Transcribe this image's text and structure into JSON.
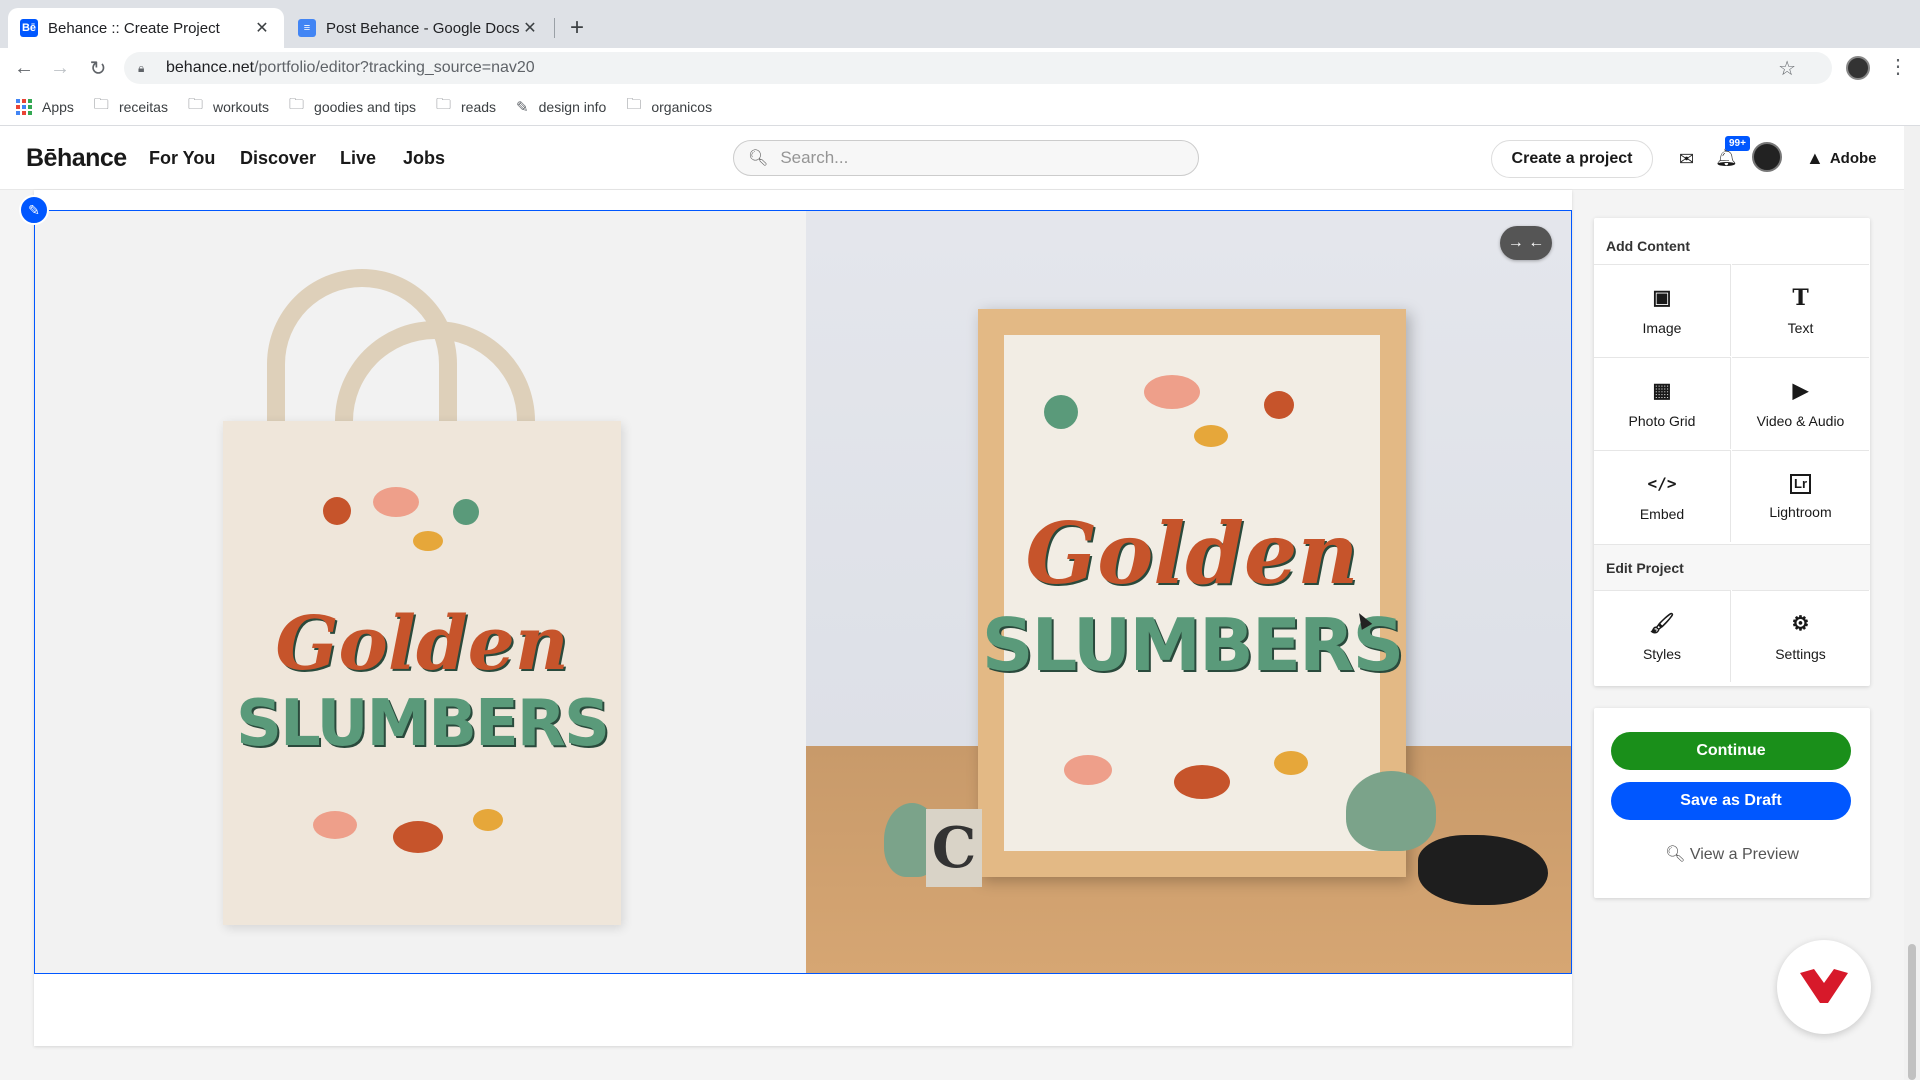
{
  "browser": {
    "tabs": [
      {
        "title": "Behance :: Create Project",
        "favicon": "Bē",
        "active": true
      },
      {
        "title": "Post Behance - Google Docs",
        "favicon": "≡",
        "active": false
      }
    ],
    "url_host": "behance.net",
    "url_path": "/portfolio/editor?tracking_source=nav20",
    "bookmarks": [
      "Apps",
      "receitas",
      "workouts",
      "goodies and tips",
      "reads",
      "design info",
      "organicos"
    ]
  },
  "header": {
    "logo": "Bēhance",
    "nav": [
      "For You",
      "Discover",
      "Live",
      "Jobs"
    ],
    "search_placeholder": "Search...",
    "create_project": "Create a project",
    "notif_count": "99+",
    "adobe": "Adobe"
  },
  "artwork": {
    "line1": "Golden",
    "line2": "SLUMBERS",
    "letter_block": "C"
  },
  "panel": {
    "add_content_heading": "Add Content",
    "add_items": [
      {
        "label": "Image",
        "icon": "image-icon"
      },
      {
        "label": "Text",
        "icon": "text-icon"
      },
      {
        "label": "Photo Grid",
        "icon": "photo-grid-icon"
      },
      {
        "label": "Video & Audio",
        "icon": "play-icon"
      },
      {
        "label": "Embed",
        "icon": "code-icon"
      },
      {
        "label": "Lightroom",
        "icon": "lightroom-icon"
      }
    ],
    "edit_project_heading": "Edit Project",
    "edit_items": [
      {
        "label": "Styles",
        "icon": "brush-icon"
      },
      {
        "label": "Settings",
        "icon": "gear-icon"
      }
    ],
    "continue": "Continue",
    "save_draft": "Save as Draft",
    "preview": "View a Preview"
  },
  "colors": {
    "accent_blue": "#0057ff",
    "continue_green": "#1a8f1a",
    "save_blue": "#0057ff"
  }
}
